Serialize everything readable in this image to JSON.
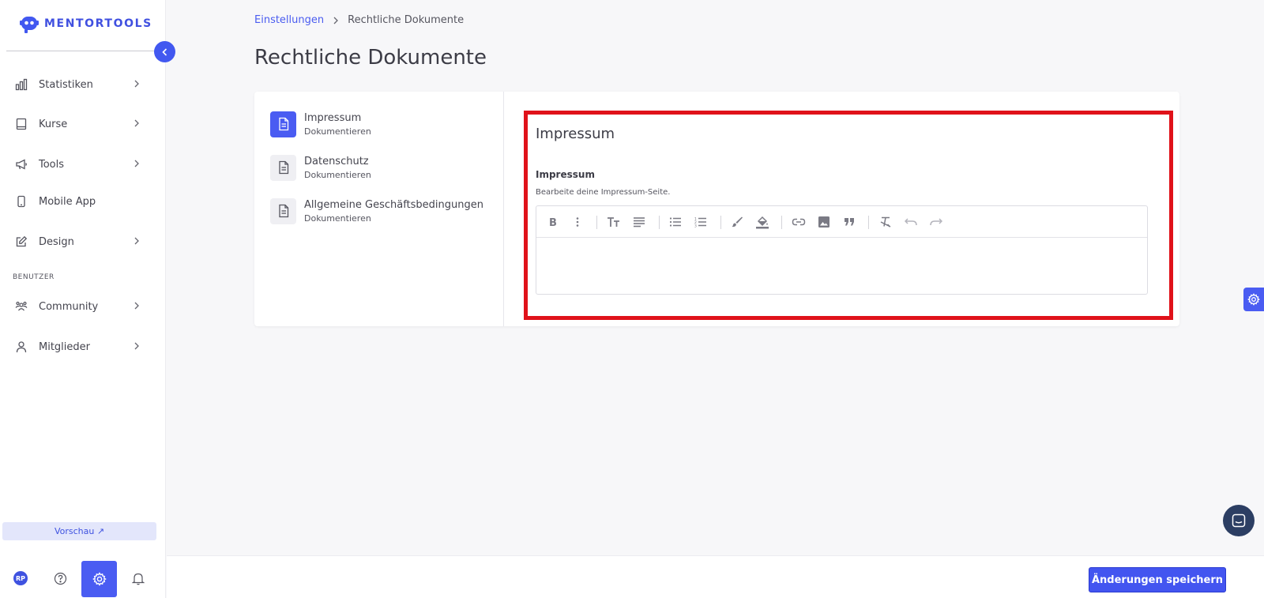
{
  "app": {
    "logo_text": "MENTORTOOLS"
  },
  "sidebar": {
    "items": [
      {
        "label": "Statistiken",
        "icon": "bar-chart-icon",
        "has_children": true
      },
      {
        "label": "Kurse",
        "icon": "book-icon",
        "has_children": true
      },
      {
        "label": "Tools",
        "icon": "megaphone-icon",
        "has_children": true
      },
      {
        "label": "Mobile App",
        "icon": "phone-icon",
        "has_children": false
      },
      {
        "label": "Design",
        "icon": "pencil-icon",
        "has_children": true
      },
      {
        "label": "Community",
        "icon": "people-icon",
        "has_children": true
      },
      {
        "label": "Mitglieder",
        "icon": "user-icon",
        "has_children": true
      }
    ],
    "section_users": "BENUTZER",
    "preview_label": "Vorschau ↗",
    "avatar_initials": "RP"
  },
  "breadcrumb": {
    "parent": "Einstellungen",
    "current": "Rechtliche Dokumente"
  },
  "page_title": "Rechtliche Dokumente",
  "documents": [
    {
      "title": "Impressum",
      "subtitle": "Dokumentieren",
      "active": true
    },
    {
      "title": "Datenschutz",
      "subtitle": "Dokumentieren",
      "active": false
    },
    {
      "title": "Allgemeine Geschäftsbedingungen",
      "subtitle": "Dokumentieren",
      "active": false
    }
  ],
  "editor": {
    "heading": "Impressum",
    "field_label": "Impressum",
    "help_text": "Bearbeite deine Impressum-Seite.",
    "content": ""
  },
  "footer": {
    "save_label": "Änderungen speichern"
  },
  "colors": {
    "accent": "#4a5cf2",
    "highlight": "#e0121a"
  }
}
